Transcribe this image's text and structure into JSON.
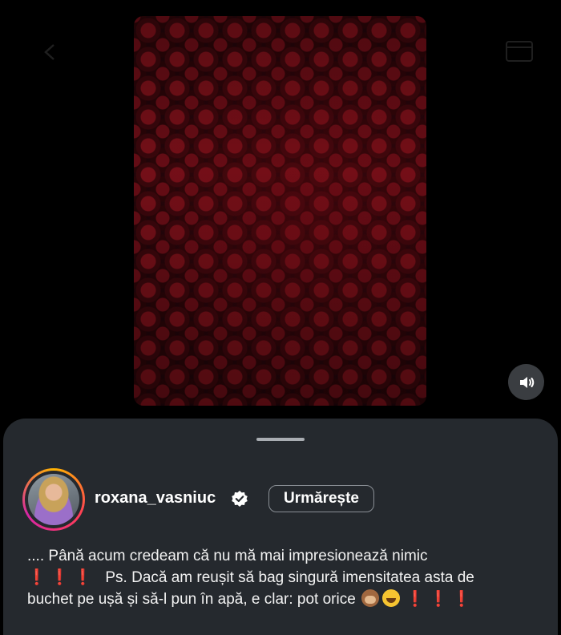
{
  "post": {
    "username": "roxana_vasniuc",
    "follow_label": "Urmărește",
    "caption": {
      "line1": ".... Până acum credeam că nu mă mai impresionează nimic",
      "line2_marks": "❗ ❗ ❗",
      "line2_text": "Ps. Dacă am reușit să bag singură imensitatea asta de",
      "line3_text": "buchet pe ușă și să-l pun în apă, e clar: pot orice",
      "line3_marks": "❗ ❗ ❗"
    }
  },
  "icons": {
    "back": "back-arrow-icon",
    "top_right": "calendar-icon",
    "volume": "speaker-icon",
    "verified": "verified-badge-icon",
    "emoji_1": "see-no-evil-monkey-emoji",
    "emoji_2": "tears-of-joy-emoji"
  },
  "colors": {
    "sheet_background": "#25292e",
    "exclamation": "#e0162b",
    "avatar_ring": [
      "#ffb400",
      "#ff3d57",
      "#d626a5"
    ]
  }
}
